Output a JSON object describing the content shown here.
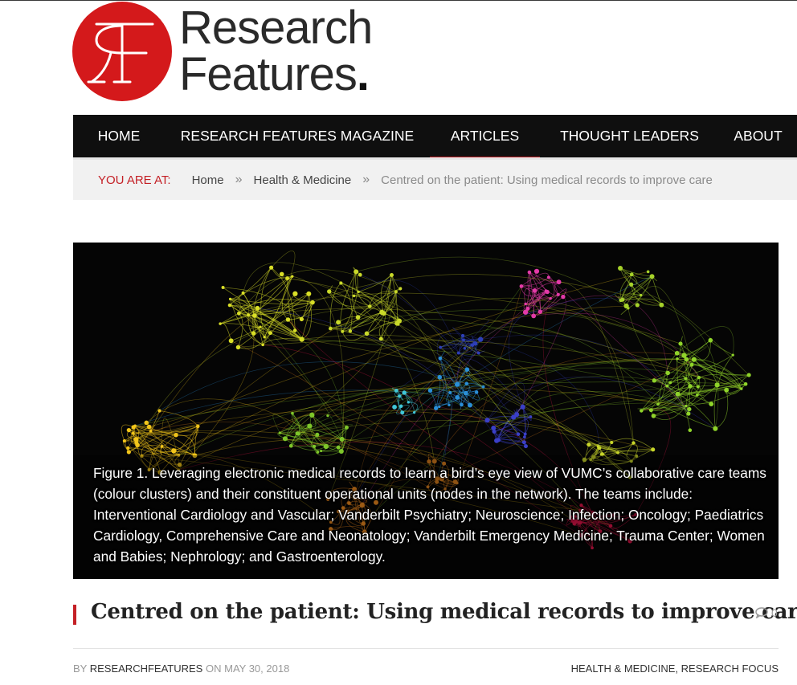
{
  "logo": {
    "monogram": "RF",
    "line1": "Research",
    "line2": "Features",
    "dot": ".",
    "brand_color": "#d4191b"
  },
  "nav": {
    "items": [
      {
        "label": "HOME"
      },
      {
        "label": "RESEARCH FEATURES MAGAZINE"
      },
      {
        "label": "ARTICLES",
        "active": true
      },
      {
        "label": "THOUGHT LEADERS"
      },
      {
        "label": "ABOUT"
      }
    ],
    "accent_color": "#c42026"
  },
  "breadcrumb": {
    "label": "YOU ARE AT:",
    "separator": "»",
    "items": [
      "Home",
      "Health & Medicine"
    ],
    "current": "Centred on the patient: Using medical records to improve care"
  },
  "hero": {
    "caption": "Figure 1. Leveraging electronic medical records to learn a bird’s eye view of VUMC’s collaborative care teams (colour clusters) and their constituent operational units (nodes in the network). The teams include: Interventional Cardiology and Vascular; Vanderbilt Psychiatry; Neuroscience; Infection; Oncology; Paediatrics Cardiology, Comprehensive Care and Neonatology; Vanderbilt Emergency Medicine; Trauma Center; Women and Babies; Nephrology; and Gastroenterology."
  },
  "article": {
    "title": "Centred on the patient: Using medical records to improve care",
    "comment_count": "0",
    "comment_icon": "comment-bubble-icon",
    "by": "BY",
    "author": "RESEARCHFEATURES",
    "on": "ON",
    "date": "MAY 30, 2018",
    "categories": [
      "HEALTH & MEDICINE",
      "RESEARCH FOCUS"
    ],
    "category_separator": ", "
  }
}
